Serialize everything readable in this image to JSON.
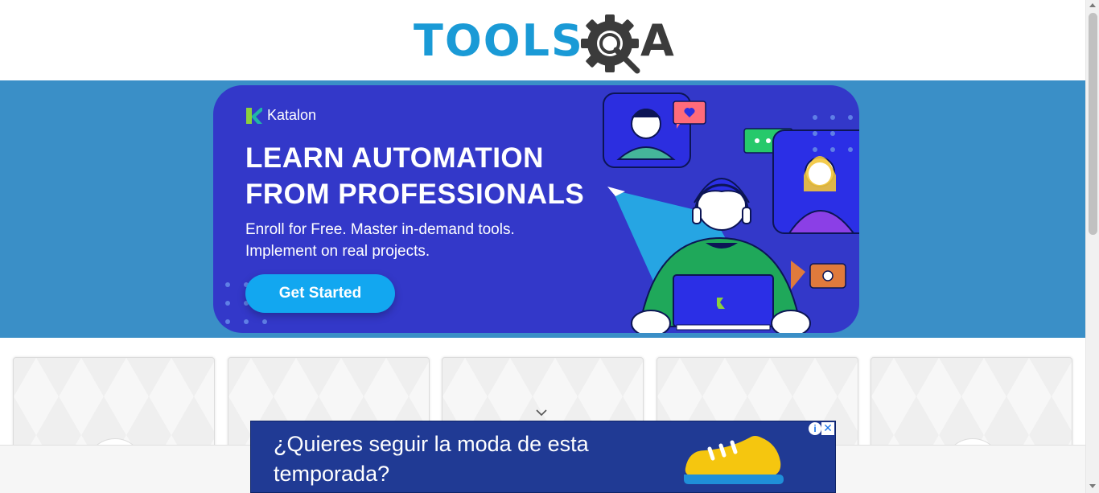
{
  "header": {
    "logo_text": "TOOLS",
    "logo_suffix": "A"
  },
  "banner": {
    "brand": "Katalon",
    "headline": "LEARN AUTOMATION FROM PROFESSIONALS",
    "subtext": "Enroll for Free. Master in-demand tools. Implement on real projects.",
    "cta_label": "Get Started",
    "colors": {
      "band": "#3a8fc7",
      "card": "#3338c9",
      "cta": "#12a7f0"
    },
    "icons": [
      "katalon-logo-icon",
      "paper-plane-icon",
      "heart-chat-icon",
      "dots-chat-icon",
      "camera-icon",
      "laptop-icon"
    ]
  },
  "cards": {
    "count": 5,
    "icons": [
      "category-icon",
      "category-icon",
      "category-icon",
      "category-icon",
      "category-icon"
    ]
  },
  "ad": {
    "text": "¿Quieres seguir la moda de esta temporada?",
    "info_label": "i",
    "close_label": "✕",
    "colors": {
      "background": "#203a94",
      "shoe": "#f5c60f"
    }
  }
}
